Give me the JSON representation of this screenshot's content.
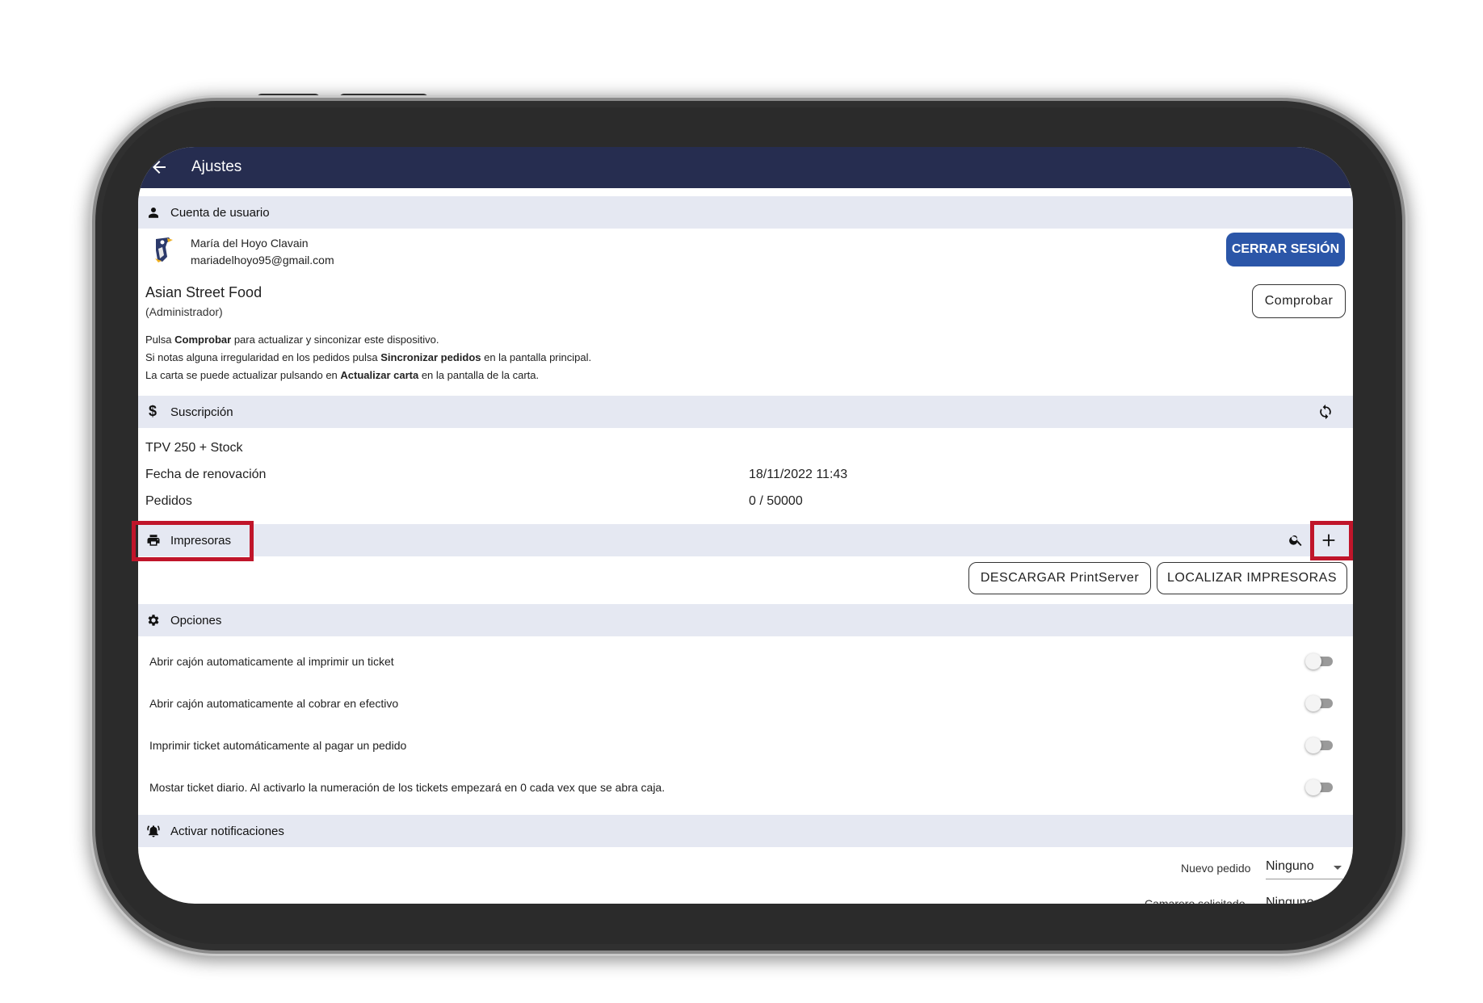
{
  "appbar": {
    "title": "Ajustes"
  },
  "account": {
    "header": "Cuenta de usuario",
    "user_name": "María del Hoyo Clavain",
    "user_email": "mariadelhoyo95@gmail.com",
    "logout_label": "CERRAR SESIÓN",
    "business_name": "Asian Street Food",
    "role": "(Administrador)",
    "check_label": "Comprobar",
    "help": [
      {
        "pre": "Pulsa ",
        "bold": "Comprobar",
        "post": " para actualizar y sinconizar este dispositivo."
      },
      {
        "pre": "Si notas alguna irregularidad en los pedidos pulsa ",
        "bold": "Sincronizar pedidos",
        "post": " en la pantalla principal."
      },
      {
        "pre": "La carta se puede actualizar pulsando en ",
        "bold": "Actualizar carta",
        "post": " en la pantalla de la carta."
      }
    ]
  },
  "subscription": {
    "header": "Suscripción",
    "plan": "TPV 250 + Stock",
    "renewal_label": "Fecha de renovación",
    "renewal_value": "18/11/2022 11:43",
    "orders_label": "Pedidos",
    "orders_value": "0 / 50000"
  },
  "printers": {
    "header": "Impresoras",
    "download_label": "DESCARGAR PrintServer",
    "locate_label": "LOCALIZAR IMPRESORAS"
  },
  "options": {
    "header": "Opciones",
    "items": [
      {
        "label": "Abrir cajón automaticamente al imprimir un ticket",
        "enabled": false
      },
      {
        "label": "Abrir cajón automaticamente al cobrar en efectivo",
        "enabled": false
      },
      {
        "label": "Imprimir ticket automáticamente al pagar un pedido",
        "enabled": false
      },
      {
        "label": "Mostar ticket diario. Al activarlo la numeración de los tickets empezará en 0 cada vex que se abra caja.",
        "enabled": false
      }
    ]
  },
  "notifications": {
    "header": "Activar notificaciones",
    "new_order_label": "Nuevo pedido",
    "new_order_value": "Ninguno",
    "waiter_label": "Camarero solicitado",
    "waiter_value": "Ninguno"
  },
  "colors": {
    "appbar": "#262d50",
    "section": "#e5e8f2",
    "primary": "#2b56a8",
    "highlight": "#c0152a"
  }
}
